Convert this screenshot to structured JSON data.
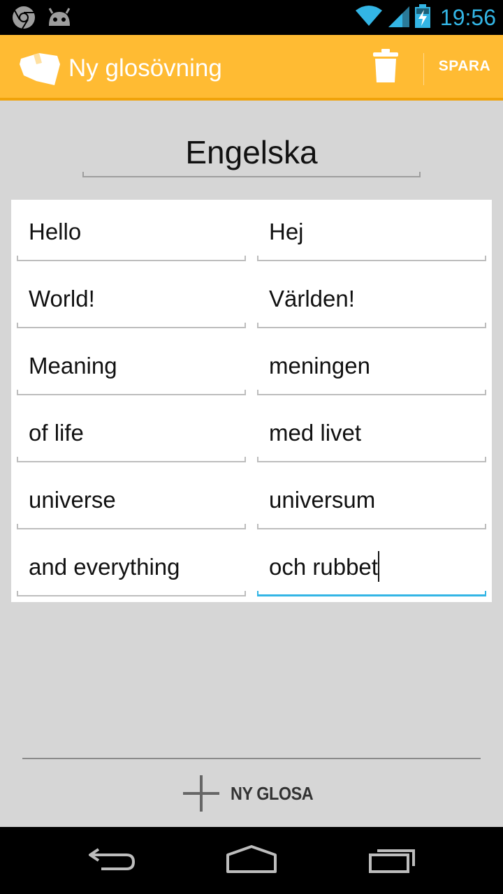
{
  "status_bar": {
    "time": "19:56",
    "icons": [
      "chrome-icon",
      "android-icon",
      "wifi-icon",
      "signal-icon",
      "battery-charging-icon"
    ]
  },
  "action_bar": {
    "title": "Ny glosövning",
    "save_label": "SPARA",
    "background_color": "#ffbb33",
    "icons": [
      "app-logo-icon",
      "trash-icon"
    ]
  },
  "language": {
    "value": "Engelska"
  },
  "glossary": [
    {
      "word": "Hello",
      "translation": "Hej"
    },
    {
      "word": "World!",
      "translation": "Världen!"
    },
    {
      "word": "Meaning",
      "translation": "meningen"
    },
    {
      "word": "of life",
      "translation": "med livet"
    },
    {
      "word": "universe",
      "translation": "universum"
    },
    {
      "word": "and everything",
      "translation": "och rubbet"
    }
  ],
  "add_button": {
    "label": "NY GLOSA",
    "icon": "plus-icon"
  },
  "nav_bar": {
    "icons": [
      "back-icon",
      "home-icon",
      "recent-apps-icon"
    ]
  },
  "colors": {
    "accent": "#33b5e5",
    "action_bar": "#ffbb33",
    "content_bg": "#d6d6d6"
  }
}
